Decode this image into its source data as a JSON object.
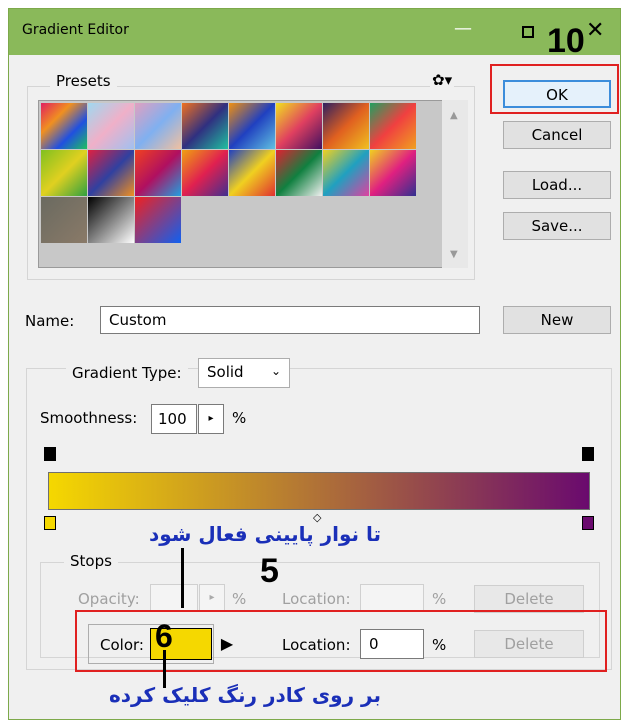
{
  "window": {
    "title": "Gradient Editor"
  },
  "annotations": {
    "step10": "10",
    "step5": "5",
    "step6": "6",
    "fa_top": "تا نوار پایینی فعال شود",
    "fa_bottom": "بر روی کادر رنگ کلیک کرده"
  },
  "presets": {
    "label": "Presets",
    "gear_icon": "gear-icon"
  },
  "buttons": {
    "ok": "OK",
    "cancel": "Cancel",
    "load": "Load...",
    "save": "Save...",
    "new": "New"
  },
  "name": {
    "label": "Name:",
    "value": "Custom"
  },
  "gradient": {
    "type_label": "Gradient Type:",
    "type_value": "Solid",
    "smoothness_label": "Smoothness:",
    "smoothness_value": "100",
    "percent": "%",
    "start_color": "#f5d800",
    "end_color": "#6a0a6e"
  },
  "stops": {
    "label": "Stops",
    "opacity_label": "Opacity:",
    "opacity_unit": "%",
    "location_label": "Location:",
    "location_unit": "%",
    "delete_label": "Delete",
    "color_label": "Color:",
    "color_value": "#f5d800",
    "color_location_label": "Location:",
    "color_location_value": "0",
    "color_location_unit": "%",
    "color_delete_label": "Delete"
  }
}
